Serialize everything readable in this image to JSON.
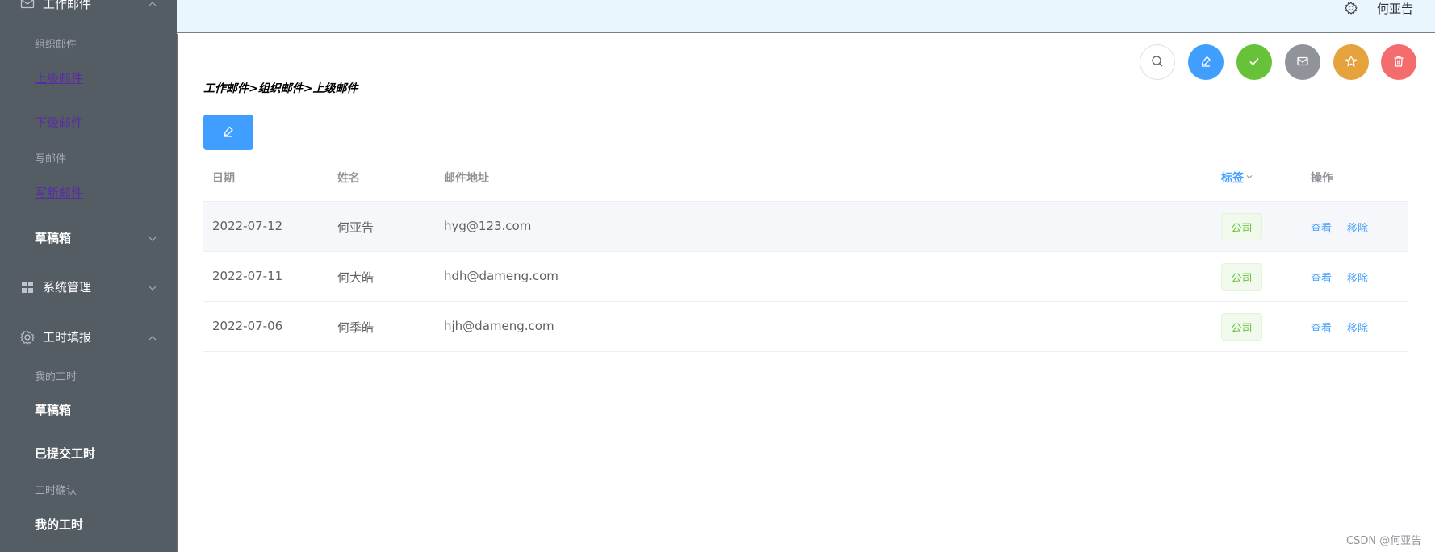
{
  "header": {
    "username": "何亚告"
  },
  "sidebar": {
    "groups": [
      {
        "label": "工作邮件",
        "icon": "mail-icon",
        "expanded": true
      },
      {
        "label": "系统管理",
        "icon": "grid-icon",
        "expanded": false
      },
      {
        "label": "工时填报",
        "icon": "gear-icon",
        "expanded": true
      }
    ],
    "items": [
      {
        "label": "组织邮件"
      },
      {
        "label": "上级邮件"
      },
      {
        "label": "下级邮件"
      },
      {
        "label": "写邮件"
      },
      {
        "label": "写新邮件"
      },
      {
        "label": "草稿箱"
      },
      {
        "label": "我的工时"
      },
      {
        "label": "草稿箱"
      },
      {
        "label": "已提交工时"
      },
      {
        "label": "工时确认"
      },
      {
        "label": "我的工时"
      }
    ]
  },
  "main": {
    "breadcrumb": "工作邮件>组织邮件>上级邮件",
    "toolbar": {
      "colors": {
        "primary": "#409eff",
        "success": "#67c23a",
        "info": "#909399",
        "warning": "#e6a23c",
        "danger": "#f56c6c"
      }
    },
    "table": {
      "columns": [
        "日期",
        "姓名",
        "邮件地址",
        "标签",
        "操作"
      ],
      "rows": [
        {
          "date": "2022-07-12",
          "name": "何亚告",
          "email": "hyg@123.com",
          "tag": "公司",
          "view": "查看",
          "remove": "移除"
        },
        {
          "date": "2022-07-11",
          "name": "何大皓",
          "email": "hdh@dameng.com",
          "tag": "公司",
          "view": "查看",
          "remove": "移除"
        },
        {
          "date": "2022-07-06",
          "name": "何季皓",
          "email": "hjh@dameng.com",
          "tag": "公司",
          "view": "查看",
          "remove": "移除"
        }
      ]
    }
  },
  "watermark": "CSDN @何亚告"
}
